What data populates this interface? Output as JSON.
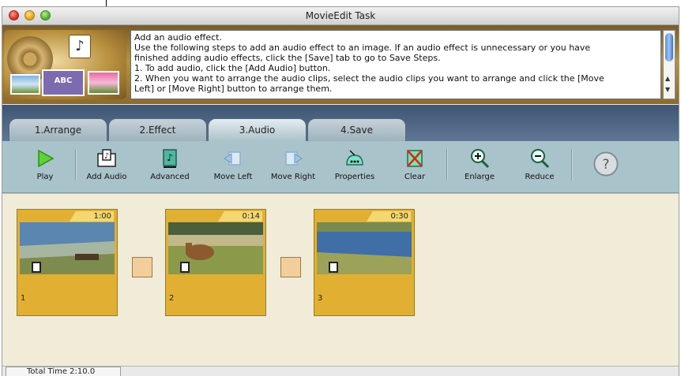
{
  "window": {
    "title": "MovieEdit Task"
  },
  "instructions": {
    "lines": [
      "Add an audio effect.",
      "Use the following steps to add an audio effect to an image. If an audio effect is unnecessary or you have",
      "finished adding audio effects, click the [Save] tab to go to Save Steps.",
      "1. To add audio, click the [Add Audio] button.",
      "2. When you want to arrange the audio clips, select the audio clips you want to arrange and click the [Move",
      "Left] or [Move Right] button to arrange them."
    ]
  },
  "logo": {
    "badge": "ABC"
  },
  "tabs": [
    {
      "label": "1.Arrange"
    },
    {
      "label": "2.Effect"
    },
    {
      "label": "3.Audio",
      "active": true
    },
    {
      "label": "4.Save"
    }
  ],
  "toolbar": {
    "play": "Play",
    "add_audio": "Add Audio",
    "advanced": "Advanced",
    "move_left": "Move Left",
    "move_right": "Move Right",
    "properties": "Properties",
    "clear": "Clear",
    "enlarge": "Enlarge",
    "reduce": "Reduce",
    "help": "?"
  },
  "clips": [
    {
      "number": "1",
      "duration": "1:00"
    },
    {
      "number": "2",
      "duration": "0:14"
    },
    {
      "number": "3",
      "duration": "0:30"
    }
  ],
  "status": {
    "total_time": "Total Time  2:10.0"
  },
  "colors": {
    "accent": "#e1b033",
    "tab_bar": "#4a6282",
    "toolbar": "#a9c3ca",
    "timeline": "#f1ecd8"
  }
}
